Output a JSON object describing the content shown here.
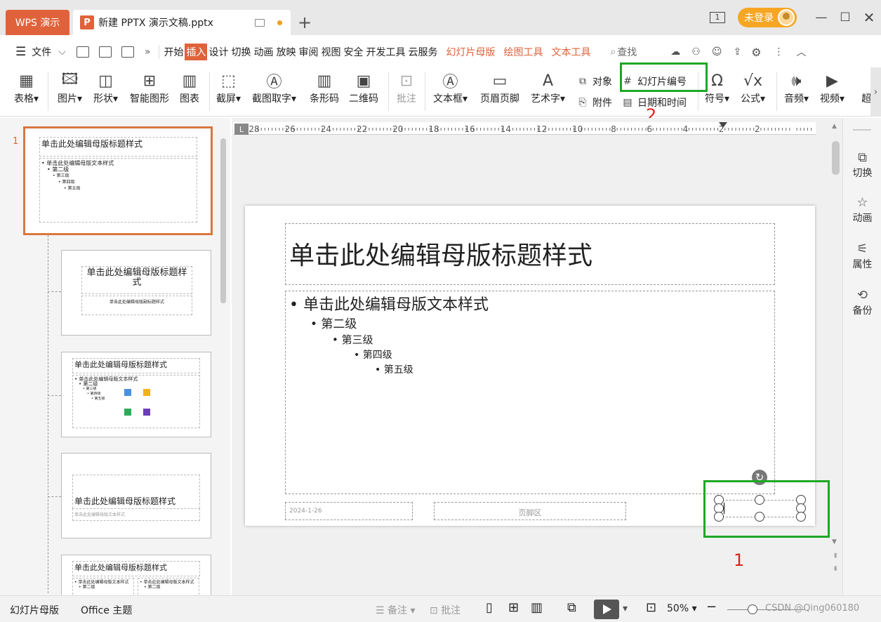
{
  "tabs": {
    "app_tab": "WPS 演示",
    "doc_badge": "P",
    "doc_title": "新建 PPTX 演示文稿.pptx",
    "new_tab": "+"
  },
  "window": {
    "layout_icon": "1",
    "login_label": "未登录"
  },
  "menu": {
    "file": "文件",
    "items": [
      "开始",
      "插入",
      "设计",
      "切换",
      "动画",
      "放映",
      "审阅",
      "视图",
      "安全",
      "开发工具",
      "云服务"
    ],
    "active": "插入",
    "contextual": [
      "幻灯片母版",
      "绘图工具",
      "文本工具"
    ],
    "search": "查找"
  },
  "ribbon": {
    "table": "表格",
    "picture": "图片",
    "shape": "形状",
    "smartart": "智能图形",
    "chart": "图表",
    "screenshot": "截屏",
    "ocr": "截图取字",
    "barcode": "条形码",
    "qrcode": "二维码",
    "comment": "批注",
    "textbox": "文本框",
    "header_footer": "页眉页脚",
    "wordart": "艺术字",
    "object": "对象",
    "attachment": "附件",
    "slide_number": "幻灯片编号",
    "date_time": "日期和时间",
    "symbol": "符号",
    "formula": "公式",
    "audio": "音频",
    "video": "视频",
    "more": "超"
  },
  "annotations": {
    "label_1": "1",
    "label_2": "2",
    "highlight_color": "#1ea826",
    "label_color": "#e02020"
  },
  "thumbnails": {
    "selected_index": "1",
    "t1_title": "单击此处编辑母版标题样式",
    "t1_body": [
      "• 单击此处编辑母版文本样式",
      "• 第二级",
      "• 第三级",
      "• 第四级",
      "• 第五级"
    ],
    "t2_title": "单击此处编辑母版标题样式",
    "t2_sub": "单击此处编辑母版副标题样式",
    "t3_title": "单击此处编辑母版标题样式",
    "t3_body": [
      "• 单击此处编辑母版文本样式",
      "• 第二级",
      "• 第三级",
      "• 第四级",
      "• 第五级"
    ],
    "t4_title": "单击此处编辑母版标题样式",
    "t4_sub": "单击此处编辑母版文本样式",
    "t5_title": "单击此处编辑母版标题样式",
    "t5_body_left": "• 单击此处编辑母版文本样式",
    "t5_body_right": "• 单击此处编辑母版文本样式",
    "t5_level2": "• 第二级"
  },
  "ruler": {
    "ticks": [
      "28",
      "26",
      "24",
      "22",
      "20",
      "18",
      "16",
      "14",
      "12",
      "10",
      "8",
      "6",
      "4",
      "2",
      "2"
    ]
  },
  "slide": {
    "title": "单击此处编辑母版标题样式",
    "levels": [
      "• 单击此处编辑母版文本样式",
      "• 第二级",
      "• 第三级",
      "• 第四级",
      "• 第五级"
    ],
    "date": "2024-1-26",
    "footer": "页脚区"
  },
  "right_panel": {
    "transition": "切换",
    "animation": "动画",
    "properties": "属性",
    "backup": "备份"
  },
  "status": {
    "view_name": "幻灯片母版",
    "theme": "Office 主题",
    "notes": "备注",
    "comment": "批注",
    "zoom": "50%",
    "watermark": "CSDN @Qing060180"
  }
}
